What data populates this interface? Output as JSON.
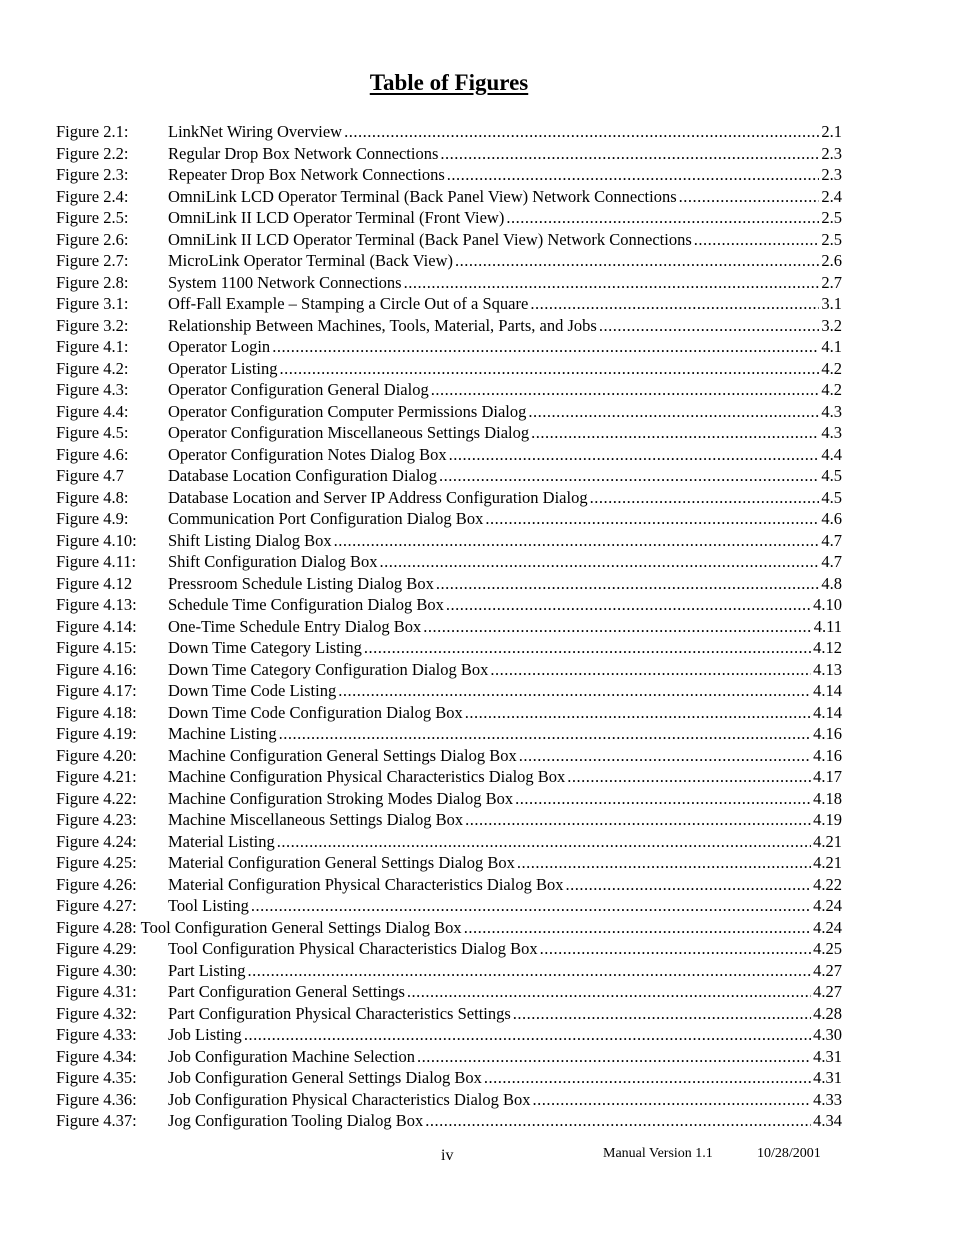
{
  "title": "Table of Figures",
  "figures": [
    {
      "num": "Figure 2.1:",
      "caption": "LinkNet Wiring Overview",
      "page": "2.1"
    },
    {
      "num": "Figure 2.2:",
      "caption": "Regular Drop Box Network Connections",
      "page": "2.3"
    },
    {
      "num": "Figure 2.3:",
      "caption": "Repeater Drop Box Network Connections",
      "page": "2.3"
    },
    {
      "num": "Figure 2.4:",
      "caption": "OmniLink LCD Operator Terminal (Back Panel View) Network Connections",
      "page": "2.4"
    },
    {
      "num": "Figure 2.5:",
      "caption": "OmniLink II LCD Operator Terminal (Front View)",
      "page": "2.5"
    },
    {
      "num": "Figure 2.6:",
      "caption": "OmniLink II LCD Operator Terminal (Back Panel View) Network Connections",
      "page": "2.5"
    },
    {
      "num": "Figure 2.7:",
      "caption": "MicroLink Operator Terminal (Back View)",
      "page": "2.6"
    },
    {
      "num": "Figure 2.8:",
      "caption": "System 1100 Network Connections",
      "page": "2.7"
    },
    {
      "num": "Figure 3.1:",
      "caption": "Off-Fall Example – Stamping a Circle Out of a Square",
      "page": "3.1"
    },
    {
      "num": "Figure 3.2:",
      "caption": "Relationship Between Machines, Tools, Material, Parts, and Jobs",
      "page": "3.2"
    },
    {
      "num": "Figure 4.1:",
      "caption": "Operator Login",
      "page": "4.1"
    },
    {
      "num": "Figure 4.2:",
      "caption": "Operator Listing",
      "page": "4.2"
    },
    {
      "num": "Figure 4.3:",
      "caption": "Operator Configuration General Dialog",
      "page": "4.2"
    },
    {
      "num": "Figure 4.4:",
      "caption": "Operator Configuration Computer Permissions Dialog",
      "page": "4.3"
    },
    {
      "num": "Figure 4.5:",
      "caption": "Operator Configuration Miscellaneous Settings Dialog",
      "page": "4.3"
    },
    {
      "num": "Figure 4.6:",
      "caption": "Operator Configuration Notes Dialog Box",
      "page": "4.4"
    },
    {
      "num": "Figure 4.7",
      "caption": "Database Location Configuration Dialog",
      "page": "4.5"
    },
    {
      "num": "Figure 4.8:",
      "caption": "Database Location and Server IP Address Configuration Dialog",
      "page": "4.5"
    },
    {
      "num": "Figure 4.9:",
      "caption": "Communication Port Configuration Dialog Box",
      "page": "4.6"
    },
    {
      "num": "Figure 4.10:",
      "caption": "Shift Listing Dialog Box",
      "page": "4.7"
    },
    {
      "num": "Figure 4.11:",
      "caption": "Shift Configuration Dialog Box",
      "page": "4.7"
    },
    {
      "num": "Figure 4.12",
      "caption": "Pressroom Schedule Listing Dialog Box",
      "page": "4.8"
    },
    {
      "num": "Figure 4.13:",
      "caption": "Schedule Time Configuration Dialog Box",
      "page": "4.10"
    },
    {
      "num": "Figure 4.14:",
      "caption": "One-Time Schedule Entry Dialog Box",
      "page": "4.11"
    },
    {
      "num": "Figure 4.15:",
      "caption": "Down Time Category Listing",
      "page": "4.12"
    },
    {
      "num": "Figure 4.16:",
      "caption": "Down Time Category Configuration Dialog Box",
      "page": "4.13"
    },
    {
      "num": "Figure 4.17:",
      "caption": "Down Time Code Listing",
      "page": "4.14"
    },
    {
      "num": "Figure 4.18:",
      "caption": "Down Time Code Configuration Dialog Box",
      "page": "4.14"
    },
    {
      "num": "Figure 4.19:",
      "caption": "Machine Listing",
      "page": "4.16"
    },
    {
      "num": "Figure 4.20:",
      "caption": "Machine Configuration General Settings Dialog Box",
      "page": "4.16"
    },
    {
      "num": "Figure 4.21:",
      "caption": "Machine Configuration Physical Characteristics Dialog Box",
      "page": "4.17"
    },
    {
      "num": "Figure 4.22:",
      "caption": "Machine Configuration Stroking Modes Dialog Box",
      "page": "4.18"
    },
    {
      "num": "Figure 4.23:",
      "caption": "Machine Miscellaneous Settings Dialog Box",
      "page": "4.19"
    },
    {
      "num": "Figure 4.24:",
      "caption": "Material Listing",
      "page": "4.21"
    },
    {
      "num": "Figure 4.25:",
      "caption": "Material Configuration General Settings Dialog Box",
      "page": "4.21"
    },
    {
      "num": "Figure 4.26:",
      "caption": "Material Configuration Physical Characteristics Dialog Box",
      "page": "4.22"
    },
    {
      "num": "Figure 4.27:",
      "caption": "Tool Listing",
      "page": "4.24"
    },
    {
      "num": "Figure 4.28:",
      "caption": "Tool Configuration General Settings Dialog Box",
      "page": "4.24",
      "inline": true
    },
    {
      "num": "Figure 4.29:",
      "caption": "Tool Configuration Physical Characteristics Dialog Box",
      "page": "4.25"
    },
    {
      "num": "Figure 4.30:",
      "caption": "Part Listing",
      "page": "4.27"
    },
    {
      "num": "Figure 4.31:",
      "caption": "Part Configuration General Settings",
      "page": "4.27"
    },
    {
      "num": "Figure 4.32:",
      "caption": "Part Configuration Physical Characteristics Settings",
      "page": "4.28"
    },
    {
      "num": "Figure 4.33:",
      "caption": "Job Listing",
      "page": "4.30"
    },
    {
      "num": "Figure 4.34:",
      "caption": "Job Configuration Machine Selection",
      "page": "4.31"
    },
    {
      "num": "Figure 4.35:",
      "caption": "Job Configuration General Settings Dialog Box",
      "page": "4.31"
    },
    {
      "num": "Figure 4.36:",
      "caption": "Job Configuration Physical Characteristics Dialog Box",
      "page": "4.33"
    },
    {
      "num": "Figure 4.37:",
      "caption": "Jog Configuration Tooling Dialog Box",
      "page": "4.34"
    }
  ],
  "footer": {
    "page_number": "iv",
    "version": "Manual Version 1.1",
    "date": "10/28/2001"
  }
}
